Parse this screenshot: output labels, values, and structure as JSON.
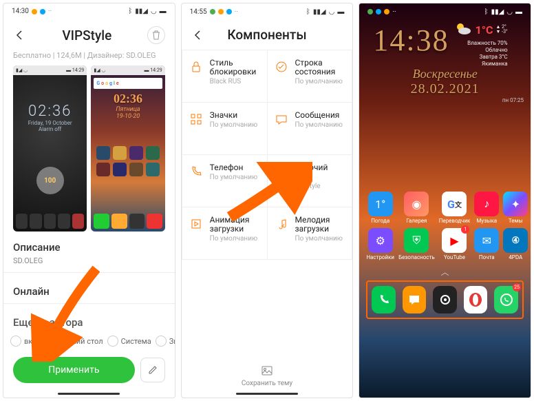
{
  "phone1": {
    "status_time": "14:30",
    "title": "VIPStyle",
    "info": "Бесплатно | 124,6M | Дизайнер: SD.OLEG",
    "preview1": {
      "time": "02:36",
      "date": "Friday, 19 October",
      "alarm": "Alarm off",
      "circle": "100"
    },
    "preview2": {
      "search": "Google",
      "time": "02:36",
      "day": "Пятница",
      "date": "19-10-20"
    },
    "section_desc": "Описание",
    "section_author": "SD.OLEG",
    "section_online": "Онлайн",
    "section_more": "Еще от автора",
    "chips": {
      "c0": "вки",
      "c1": "Рабочий стол",
      "c2": "Система",
      "c3": "Зна"
    },
    "apply": "Применить"
  },
  "phone2": {
    "status_time": "14:55",
    "title": "Компоненты",
    "items": {
      "i0": {
        "title": "Стиль блокировки",
        "sub": "Black RUS"
      },
      "i1": {
        "title": "Строка состояния",
        "sub": "По умолчанию"
      },
      "i2": {
        "title": "Значки",
        "sub": "По умолчанию"
      },
      "i3": {
        "title": "Сообщения",
        "sub": "По умолчанию"
      },
      "i4": {
        "title": "Телефон",
        "sub": "По умолчанию"
      },
      "i5": {
        "title": "Рабочий стол",
        "sub": "VIPStyle"
      },
      "i6": {
        "title": "Анимация загрузки",
        "sub": "По умолчанию"
      },
      "i7": {
        "title": "Мелодия загрузки",
        "sub": "По умолчанию"
      }
    },
    "footer": "Сохранить тему"
  },
  "phone3": {
    "time": "14:38",
    "weather": {
      "temp": "1°C",
      "hum": "Влажность 70%",
      "cond": "Облачно",
      "tom": "Завтра 3°C",
      "loc": "Якиманка"
    },
    "day": "Воскресенье",
    "date": "28.02.2021",
    "small": "пн 07:25",
    "apps_r1": {
      "a0": "Погода",
      "a1": "Галерея",
      "a2": "Переводчик",
      "a3": "Музыка",
      "a4": "Темы"
    },
    "apps_r2": {
      "a0": "Настройки",
      "a1": "Безопасность",
      "a2": "YouTube",
      "a3": "Почта",
      "a4": "4PDA"
    },
    "badges": {
      "youtube": "1",
      "whatsapp": "25"
    },
    "dock": {
      "d0": "phone",
      "d1": "messages",
      "d2": "camera",
      "d3": "opera",
      "d4": "whatsapp"
    }
  },
  "annotations": {
    "arrow1_target": "Рабочий стол chip",
    "arrow2_target": "Рабочий стол component"
  }
}
